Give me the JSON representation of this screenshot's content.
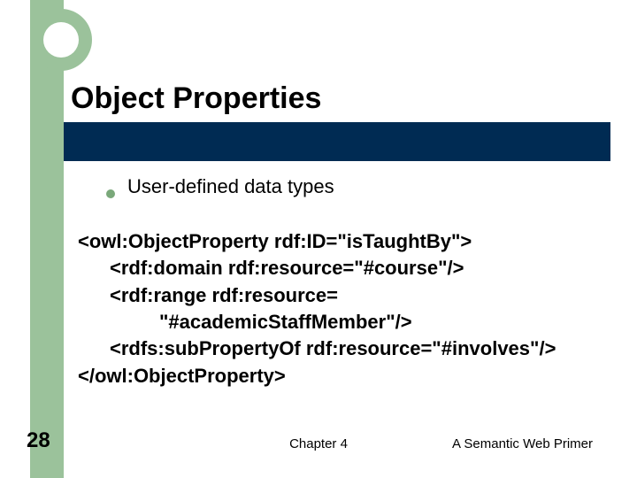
{
  "title": "Object Properties",
  "bullet": {
    "text": "User-defined data types"
  },
  "code": {
    "line1": "<owl:ObjectProperty rdf:ID=\"isTaughtBy\">",
    "line2": "<rdf:domain rdf:resource=\"#course\"/>",
    "line3": "<rdf:range rdf:resource=",
    "line4": "\"#academicStaffMember\"/>",
    "line5": "<rdfs:subPropertyOf rdf:resource=\"#involves\"/>",
    "line6": "</owl:ObjectProperty>"
  },
  "footer": {
    "slide_number": "28",
    "center": "Chapter 4",
    "right": "A Semantic Web Primer"
  }
}
